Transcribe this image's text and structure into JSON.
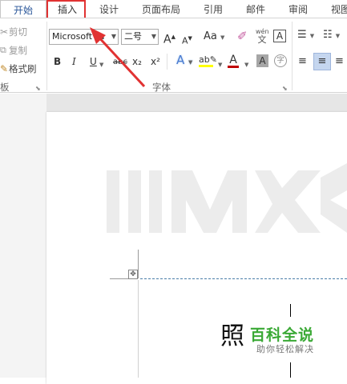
{
  "tabs": [
    {
      "label": "开始"
    },
    {
      "label": "插入"
    },
    {
      "label": "设计"
    },
    {
      "label": "页面布局"
    },
    {
      "label": "引用"
    },
    {
      "label": "邮件"
    },
    {
      "label": "审阅"
    },
    {
      "label": "视图"
    }
  ],
  "clipboard": {
    "cut": "剪切",
    "copy": "复制",
    "format_painter": "格式刷",
    "group_label": "板"
  },
  "font": {
    "font_name": "Microsoft Ya",
    "font_size": "二号",
    "group_label": "字体",
    "phonetic_top": "wén",
    "phonetic_bottom": "文",
    "char_border": "A",
    "change_case": "Aa",
    "bold": "B",
    "italic": "I",
    "underline": "U",
    "strike": "abc",
    "subscript": "x₂",
    "superscript": "x²",
    "grow": "A",
    "shrink": "A",
    "font_color": "A",
    "text_effect": "A",
    "char_shading": "A",
    "enclose": "字"
  },
  "document": {
    "char": "照",
    "logo_main": "百科全说",
    "logo_sub": "助你轻松解决"
  },
  "colors": {
    "accent": "#2b579a",
    "highlight_box": "#e13232",
    "arrow": "#e13232",
    "logo_green": "#3aa935"
  }
}
